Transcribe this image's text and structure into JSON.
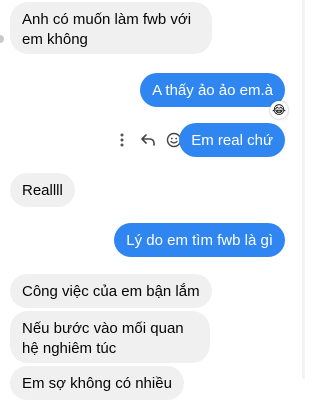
{
  "messages": [
    {
      "id": "m1",
      "from": "them",
      "text": "Anh có muốn làm fwb với em không"
    },
    {
      "id": "m2",
      "from": "me",
      "text": "A thấy ảo ảo em.à",
      "reaction": "😂"
    },
    {
      "id": "m3",
      "from": "me",
      "text": "Em real chứ"
    },
    {
      "id": "m4",
      "from": "them",
      "text": "Reallll"
    },
    {
      "id": "m5",
      "from": "me",
      "text": "Lý do em tìm fwb là gì"
    },
    {
      "id": "m6",
      "from": "them",
      "text": "Công việc của em bận lắm"
    },
    {
      "id": "m7",
      "from": "them",
      "text": "Nếu bước vào mối quan hệ nghiêm túc"
    },
    {
      "id": "m8",
      "from": "them",
      "text": "Em sợ không có nhiều"
    }
  ],
  "icons": {
    "more": "more-options-icon",
    "reply": "reply-icon",
    "react": "emoji-react-icon"
  },
  "colors": {
    "outgoing_bubble": "#2f86f0",
    "incoming_bubble": "#f0f0f0"
  }
}
